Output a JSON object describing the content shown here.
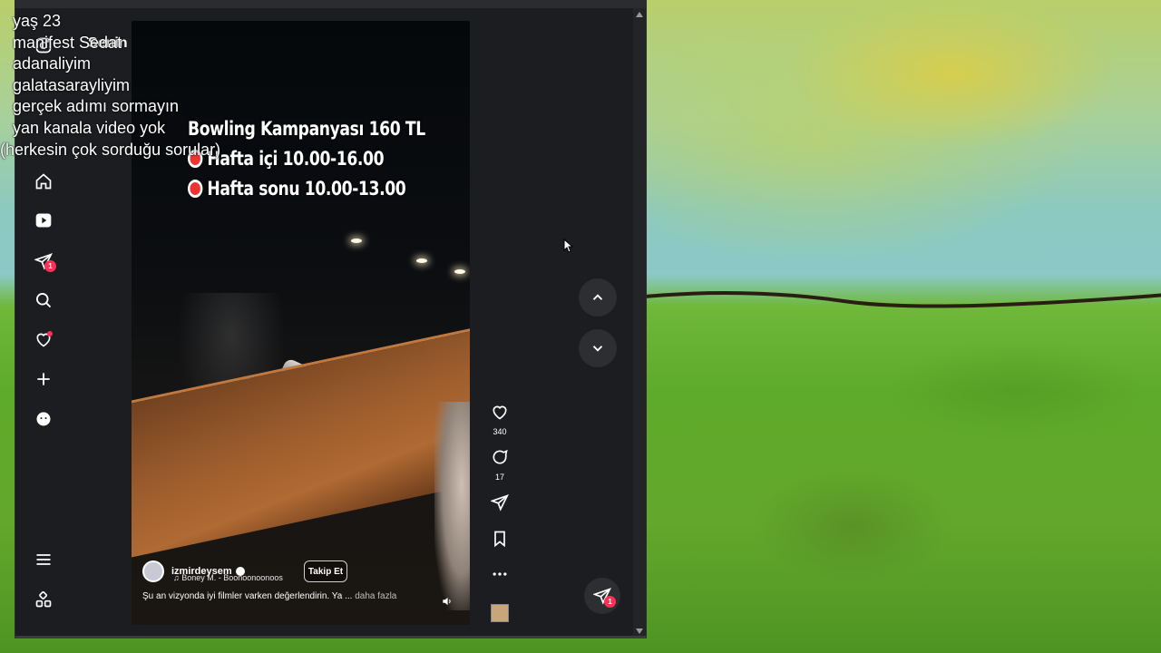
{
  "stream_overlay": {
    "lines": [
      "yaş 23",
      "manifest Sedat",
      "adanaliyim",
      "galatasarayliyim",
      "gerçek adımı sormayın",
      "yan kanala video yok",
      "(herkesin çok sorduğu sorular)"
    ]
  },
  "app": {
    "header_title": "Senin için"
  },
  "sidebar": {
    "icons": [
      "instagram-logo-icon",
      "home-icon",
      "reels-icon",
      "messages-icon",
      "search-icon",
      "notifications-icon",
      "create-icon",
      "profile-icon",
      "menu-icon",
      "more-apps-icon"
    ],
    "messages_badge": "1"
  },
  "video": {
    "overlay_lines": [
      "Bowling Kampanyası 160 TL",
      "Hafta içi 10.00-16.00",
      "Hafta sonu 10.00-13.00"
    ],
    "author": "izmirdeysem",
    "song": "♫ Boney M. - Boonoonoonoos",
    "follow_label": "Takip Et",
    "caption": "Şu an vizyonda iyi filmler varken değerlendirin. Ya ...",
    "caption_more": "daha fazla"
  },
  "actions": {
    "likes": "340",
    "comments": "17"
  },
  "floating_messages_badge": "1",
  "colors": {
    "window_bg": "#1b1d20",
    "badge": "#ff2e55",
    "accent_text": "#ffffff"
  }
}
